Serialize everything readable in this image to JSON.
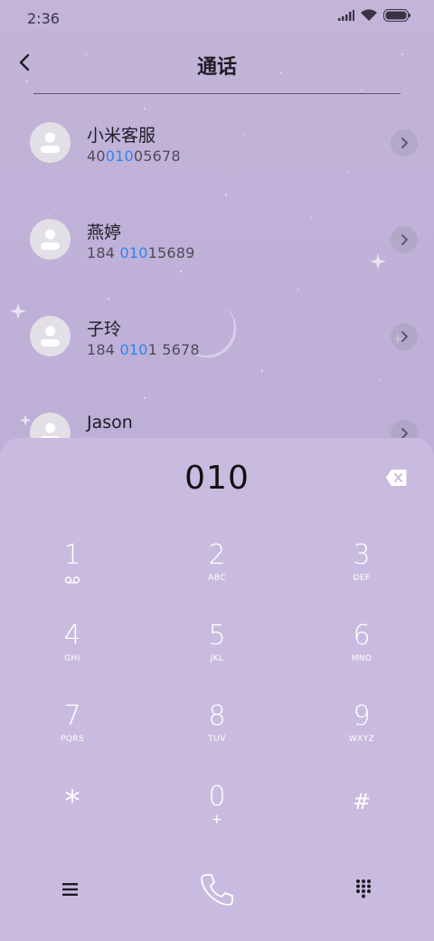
{
  "status_bar": {
    "time": "2:36"
  },
  "header": {
    "title": "通话"
  },
  "contacts": [
    {
      "name": "小米客服",
      "number_pre": "40",
      "number_hl": "010",
      "number_post": "05678"
    },
    {
      "name": "燕婷",
      "number_pre": "184 ",
      "number_hl": "010",
      "number_post": "15689"
    },
    {
      "name": "子玲",
      "number_pre": "184 ",
      "number_hl": "010",
      "number_post": "1 5678"
    },
    {
      "name": "Jason",
      "number_pre": "",
      "number_hl": "",
      "number_post": ""
    }
  ],
  "dialpad": {
    "input": "010",
    "keys": [
      {
        "digit": "1",
        "letters": ""
      },
      {
        "digit": "2",
        "letters": "ABC"
      },
      {
        "digit": "3",
        "letters": "DEF"
      },
      {
        "digit": "4",
        "letters": "GHI"
      },
      {
        "digit": "5",
        "letters": "JKL"
      },
      {
        "digit": "6",
        "letters": "MNO"
      },
      {
        "digit": "7",
        "letters": "PQRS"
      },
      {
        "digit": "8",
        "letters": "TUV"
      },
      {
        "digit": "9",
        "letters": "WXYZ"
      },
      {
        "digit": "*",
        "letters": ""
      },
      {
        "digit": "0",
        "letters": "+"
      },
      {
        "digit": "#",
        "letters": ""
      }
    ]
  },
  "icons": {
    "back": "chevron-left-icon",
    "signal": "signal-icon",
    "wifi": "wifi-icon",
    "battery": "battery-icon",
    "voicemail": "voicemail-icon",
    "backspace": "backspace-icon",
    "menu": "menu-icon",
    "call": "call-icon",
    "dialpad_toggle": "dialpad-icon"
  },
  "colors": {
    "highlight": "#2f84ea",
    "background": "#c3b4d9",
    "dialpad_bg": "#c9bbdf"
  }
}
